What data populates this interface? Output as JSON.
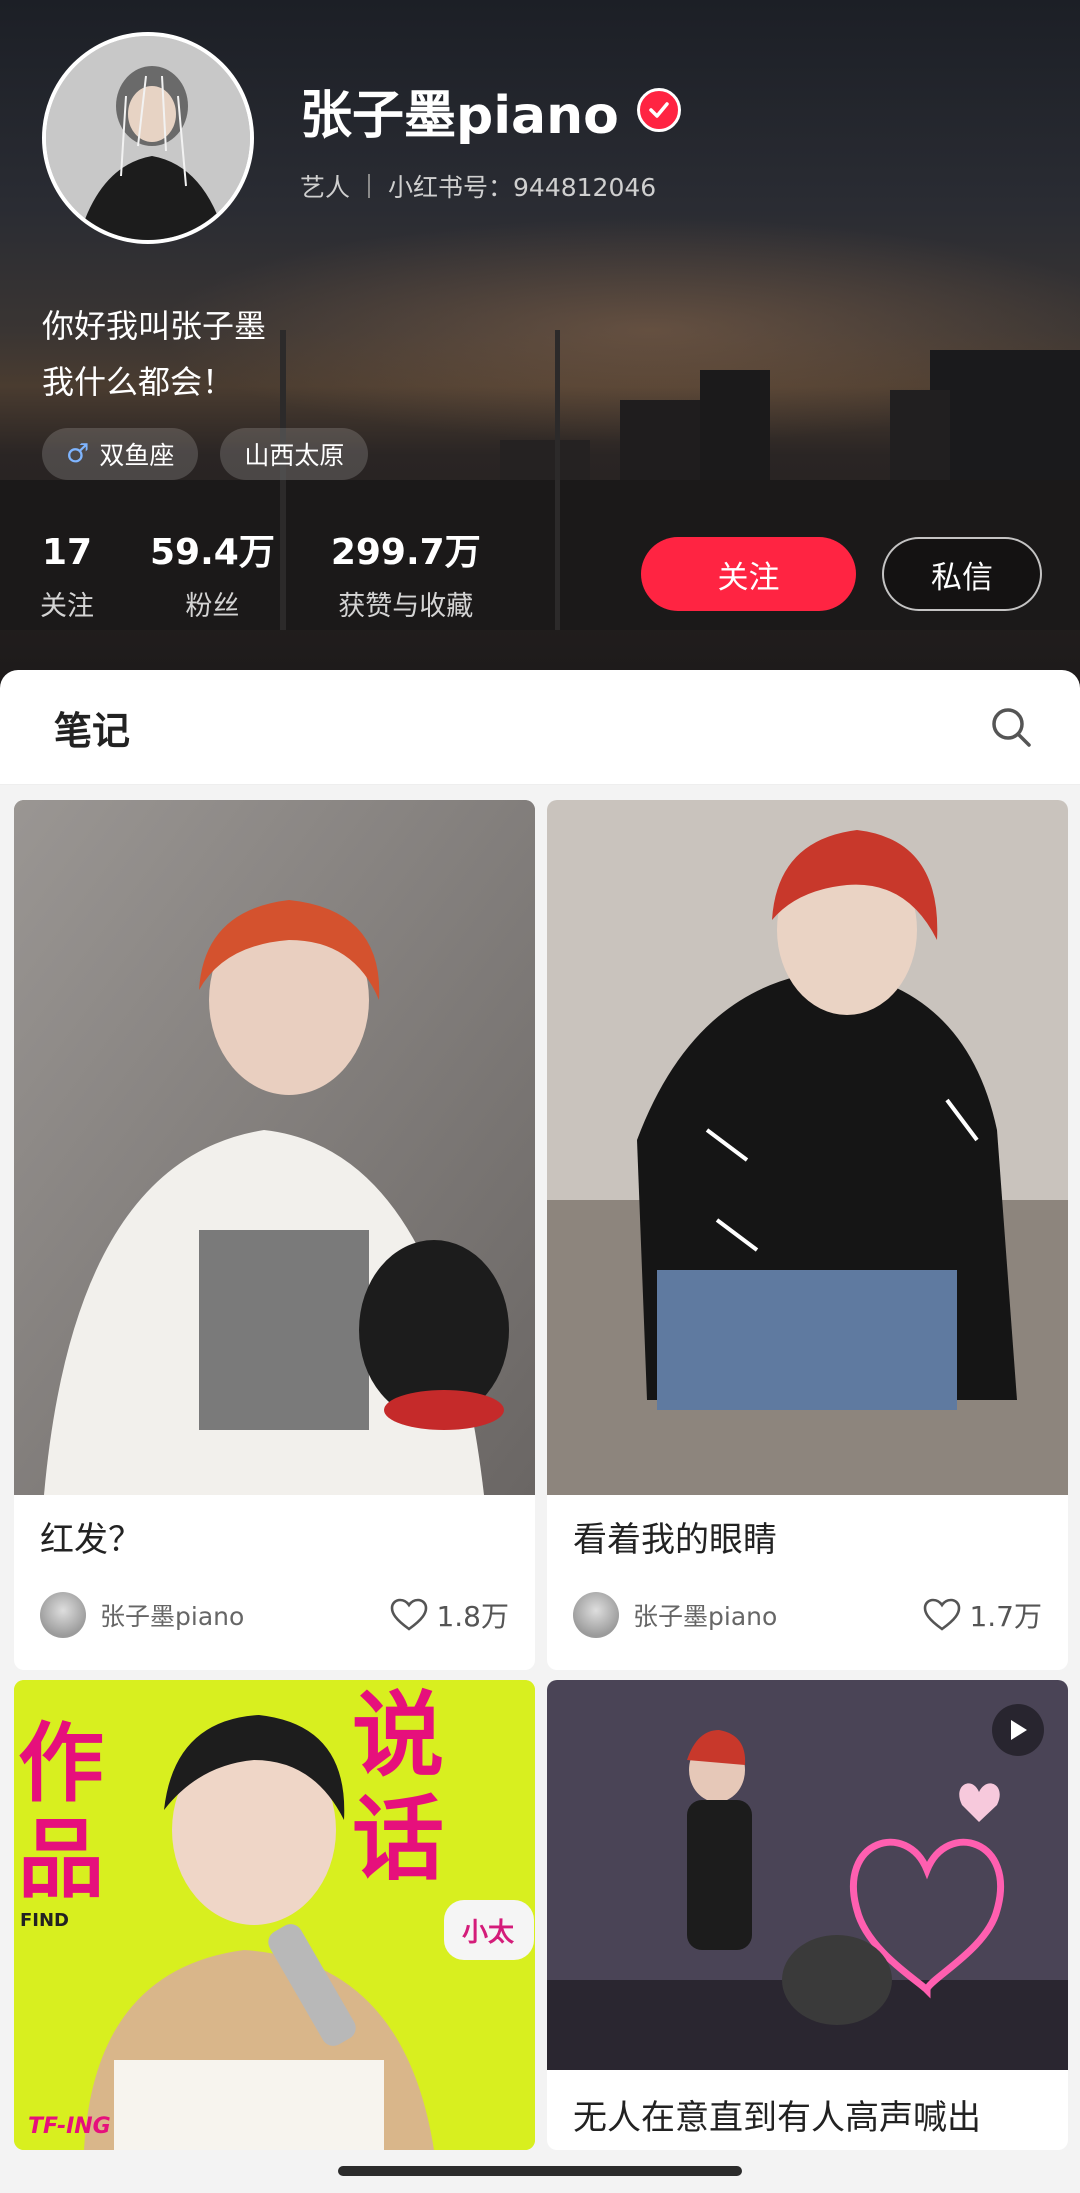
{
  "profile": {
    "name": "张子墨piano",
    "role": "艺人",
    "id_text": "小红书号：944812046",
    "bio_line1": "你好我叫张子墨",
    "bio_line2": "我什么都会！",
    "tags": [
      {
        "icon": "male-icon",
        "glyph": "♂",
        "label": "双鱼座"
      },
      {
        "label": "山西太原"
      }
    ],
    "stats": [
      {
        "value": "17",
        "label": "关注"
      },
      {
        "value": "59.4万",
        "label": "粉丝"
      },
      {
        "value": "299.7万",
        "label": "获赞与收藏"
      }
    ],
    "follow_label": "关注",
    "message_label": "私信"
  },
  "tabs": {
    "notes_label": "笔记"
  },
  "notes": [
    {
      "title": "红发？",
      "author": "张子墨piano",
      "likes": "1.8万"
    },
    {
      "title": "看着我的眼睛",
      "author": "张子墨piano",
      "likes": "1.7万"
    },
    {
      "title": "",
      "poster_text_1": "作品",
      "poster_text_2": "说话",
      "poster_brand": "TF-ING",
      "poster_find": "FIND",
      "poster_bubble": "小太",
      "author": "",
      "likes": ""
    },
    {
      "title": "无人在意直到有人高声喊出",
      "author": "",
      "likes": "",
      "is_video": true
    }
  ],
  "colors": {
    "accent": "#ff2442",
    "poster_yellow": "#d8ef1f",
    "poster_magenta": "#e6107c"
  }
}
